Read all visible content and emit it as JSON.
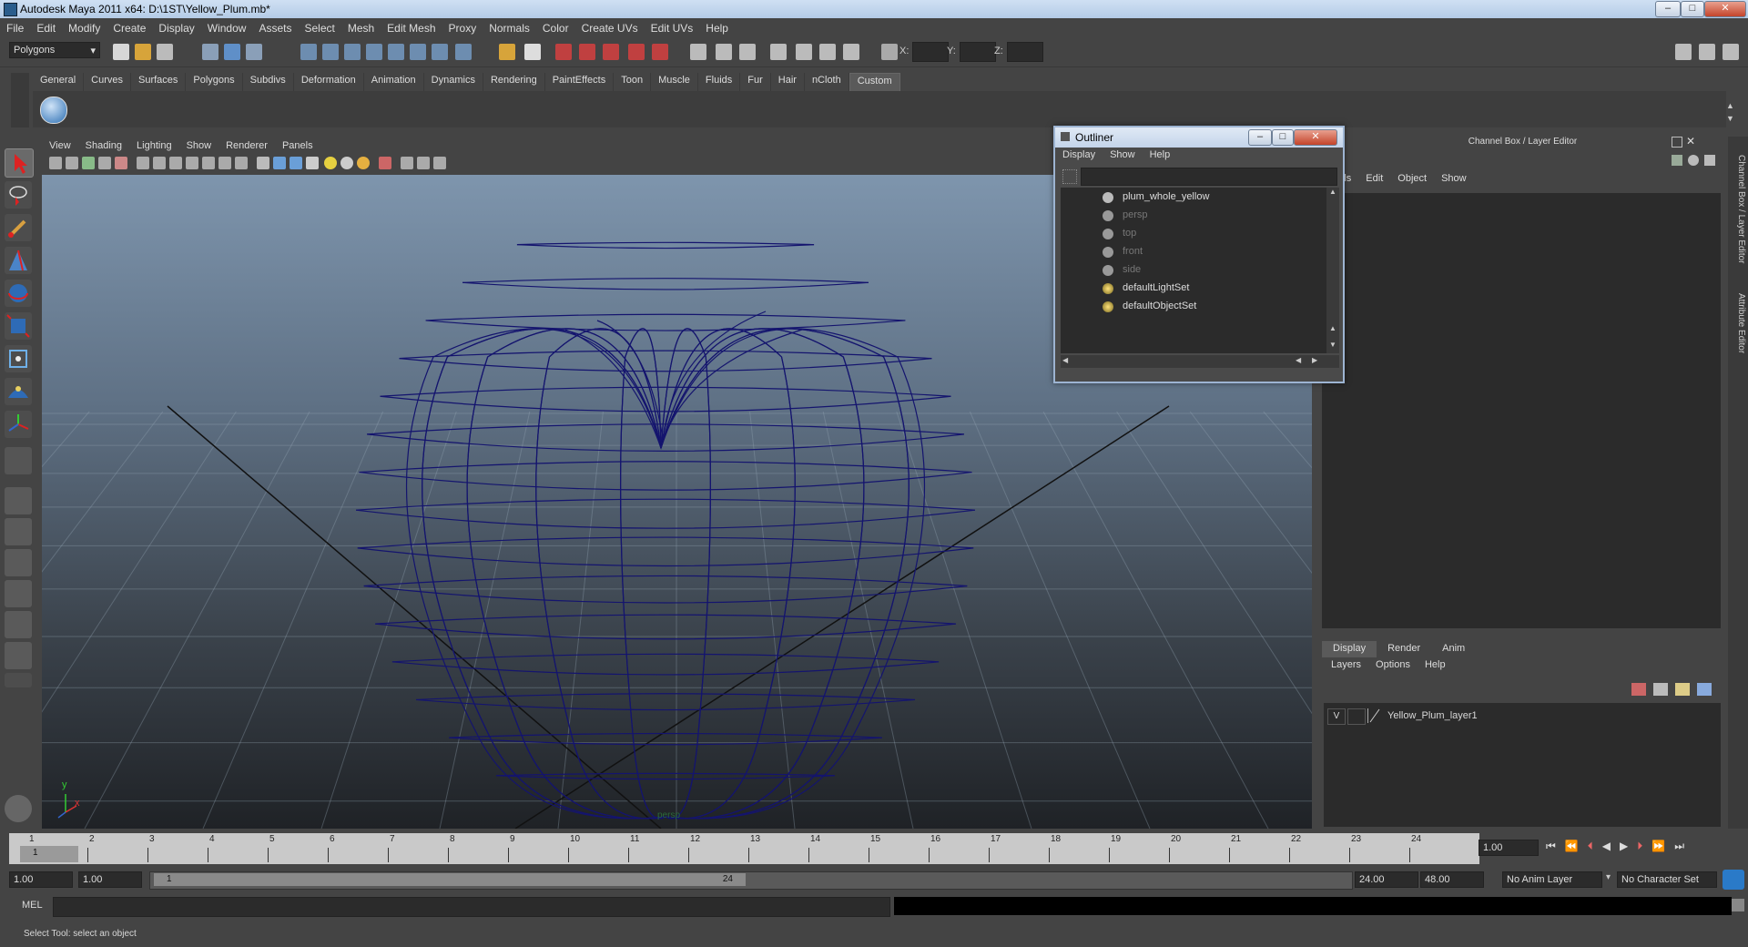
{
  "window": {
    "title": "Autodesk Maya 2011 x64: D:\\1ST\\Yellow_Plum.mb*"
  },
  "menubar": [
    "File",
    "Edit",
    "Modify",
    "Create",
    "Display",
    "Window",
    "Assets",
    "Select",
    "Mesh",
    "Edit Mesh",
    "Proxy",
    "Normals",
    "Color",
    "Create UVs",
    "Edit UVs",
    "Help"
  ],
  "statusline": {
    "mode": "Polygons",
    "x_label": "X:",
    "y_label": "Y:",
    "z_label": "Z:"
  },
  "shelf": {
    "tabs": [
      "General",
      "Curves",
      "Surfaces",
      "Polygons",
      "Subdivs",
      "Deformation",
      "Animation",
      "Dynamics",
      "Rendering",
      "PaintEffects",
      "Toon",
      "Muscle",
      "Fluids",
      "Fur",
      "Hair",
      "nCloth",
      "Custom"
    ],
    "active": "Custom"
  },
  "viewport": {
    "menu": [
      "View",
      "Shading",
      "Lighting",
      "Show",
      "Renderer",
      "Panels"
    ],
    "camera": "persp",
    "axis_y": "y",
    "axis_x": "x"
  },
  "channelbox": {
    "title": "Channel Box / Layer Editor",
    "menu": [
      "nnels",
      "Edit",
      "Object",
      "Show"
    ]
  },
  "layereditor": {
    "tabs": [
      "Display",
      "Render",
      "Anim"
    ],
    "active": "Display",
    "menu": [
      "Layers",
      "Options",
      "Help"
    ],
    "layer": {
      "visible": "V",
      "name": "Yellow_Plum_layer1"
    }
  },
  "sidetabs": [
    "Channel Box / Layer Editor",
    "Attribute Editor"
  ],
  "outliner": {
    "title": "Outliner",
    "menu": [
      "Display",
      "Show",
      "Help"
    ],
    "items": [
      {
        "label": "plum_whole_yellow",
        "dim": false
      },
      {
        "label": "persp",
        "dim": true
      },
      {
        "label": "top",
        "dim": true
      },
      {
        "label": "front",
        "dim": true
      },
      {
        "label": "side",
        "dim": true
      },
      {
        "label": "defaultLightSet",
        "dim": false
      },
      {
        "label": "defaultObjectSet",
        "dim": false
      }
    ]
  },
  "timeslider": {
    "ticks": [
      "1",
      "2",
      "3",
      "4",
      "5",
      "6",
      "7",
      "8",
      "9",
      "10",
      "11",
      "12",
      "13",
      "14",
      "15",
      "16",
      "17",
      "18",
      "19",
      "20",
      "21",
      "22",
      "23",
      "24"
    ],
    "current": "1",
    "current_field": "1.00"
  },
  "range": {
    "start": "1.00",
    "start2": "1.00",
    "inner_start": "1",
    "inner_end": "24",
    "end": "24.00",
    "end2": "48.00",
    "anim_layer": "No Anim Layer",
    "char_set": "No Character Set"
  },
  "cmdline": {
    "label": "MEL"
  },
  "helpline": {
    "text": "Select Tool: select an object"
  },
  "colors": {
    "wire": "#14146e",
    "viewport_top": "#7e95ad",
    "viewport_bottom": "#1f2226"
  }
}
